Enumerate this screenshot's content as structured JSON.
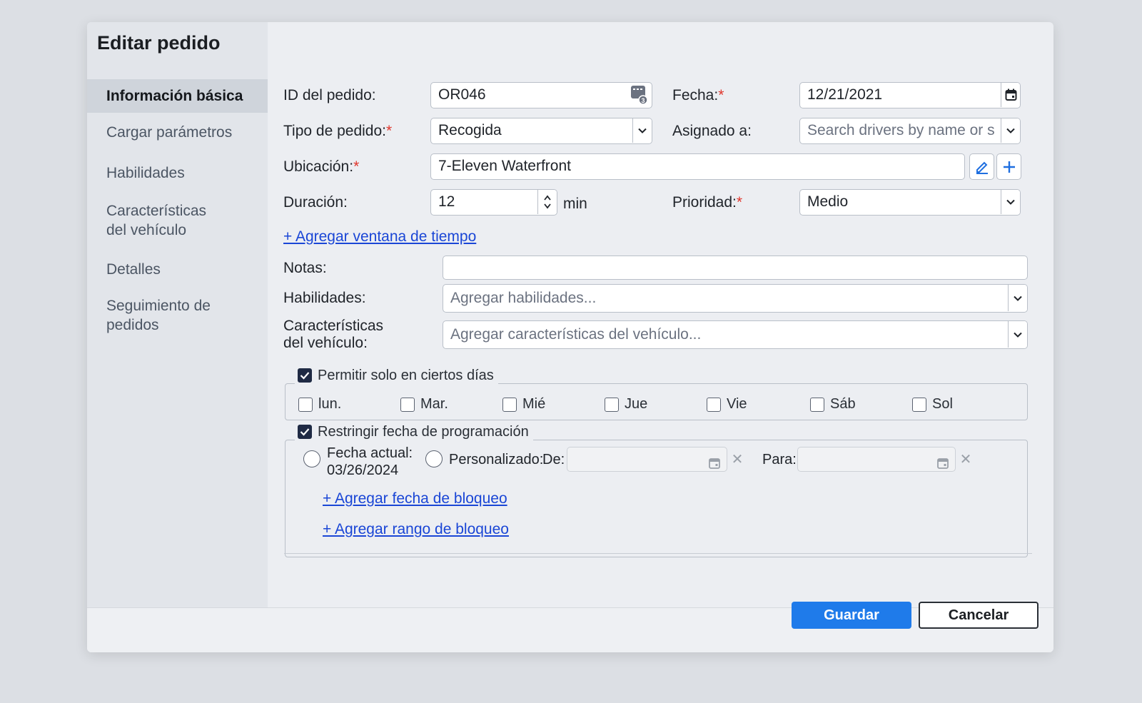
{
  "dialog": {
    "title": "Editar pedido"
  },
  "nav": {
    "items": [
      {
        "label": "Información básica",
        "active": true
      },
      {
        "label": "Cargar parámetros"
      },
      {
        "label": "Habilidades"
      },
      {
        "label": "Características del vehículo"
      },
      {
        "label": "Detalles"
      },
      {
        "label": "Seguimiento de pedidos"
      }
    ]
  },
  "form": {
    "order_id": {
      "label": "ID del pedido:",
      "value": "OR046",
      "icon": "calculator-icon"
    },
    "date": {
      "label": "Fecha:",
      "value": "12/21/2021",
      "icon": "calendar-icon"
    },
    "order_type": {
      "label": "Tipo de pedido:",
      "value": "Recogida"
    },
    "assigned_to": {
      "label": "Asignado a:",
      "placeholder": "Search drivers by name or s"
    },
    "location": {
      "label": "Ubicación:",
      "value": "7-Eleven Waterfront"
    },
    "duration": {
      "label": "Duración:",
      "value": "12",
      "unit": "min"
    },
    "priority": {
      "label": "Prioridad:",
      "value": "Medio"
    },
    "add_time_window": "+ Agregar ventana de tiempo",
    "notes": {
      "label": "Notas:",
      "value": ""
    },
    "skills": {
      "label": "Habilidades:",
      "placeholder": "Agregar habilidades..."
    },
    "vehicle_features": {
      "label_line1": "Características",
      "label_line2": "del vehículo:",
      "placeholder": "Agregar características del vehículo..."
    },
    "required_mark": "*"
  },
  "allowed_days": {
    "label": "Permitir solo en ciertos días",
    "checked": true,
    "days": [
      {
        "label": "lun.",
        "checked": false
      },
      {
        "label": "Mar.",
        "checked": false
      },
      {
        "label": "Mié",
        "checked": false
      },
      {
        "label": "Jue",
        "checked": false
      },
      {
        "label": "Vie",
        "checked": false
      },
      {
        "label": "Sáb",
        "checked": false
      },
      {
        "label": "Sol",
        "checked": false
      }
    ]
  },
  "restrict_date": {
    "label": "Restringir fecha de programación",
    "checked": true,
    "current_date_label_line1": "Fecha actual:",
    "current_date_label_line2": "03/26/2024",
    "custom_label": "Personalizado:",
    "from_label": "De:",
    "to_label": "Para:",
    "add_block_date": "+ Agregar fecha de bloqueo",
    "add_block_range": "+ Agregar rango de bloqueo"
  },
  "footer": {
    "save_label": "Guardar",
    "cancel_label": "Cancelar"
  },
  "colors": {
    "primary": "#1f7bea",
    "link": "#1a46d6",
    "required": "#e0352b"
  }
}
